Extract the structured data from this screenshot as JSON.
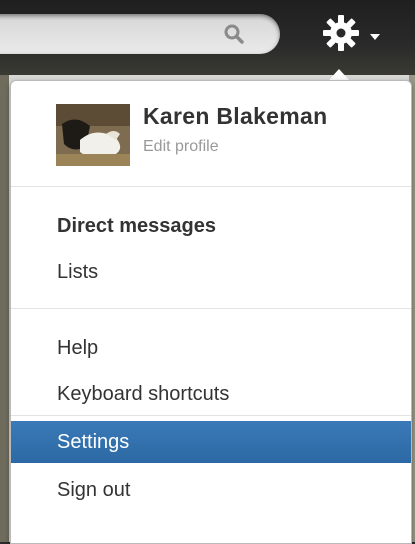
{
  "profile": {
    "name": "Karen Blakeman",
    "edit_label": "Edit profile"
  },
  "menu": {
    "group1": [
      {
        "label": "Direct messages",
        "bold": true
      },
      {
        "label": "Lists",
        "bold": false
      }
    ],
    "group2": [
      {
        "label": "Help",
        "bold": false
      },
      {
        "label": "Keyboard shortcuts",
        "bold": false
      }
    ],
    "group3": [
      {
        "label": "Settings",
        "selected": true
      },
      {
        "label": "Sign out",
        "selected": false
      }
    ]
  },
  "icons": {
    "search": "search-icon",
    "settings": "gear-icon",
    "dropdown": "chevron-down-icon"
  },
  "colors": {
    "selected_bg": "#2c69a4",
    "text": "#333333",
    "muted": "#999999"
  }
}
